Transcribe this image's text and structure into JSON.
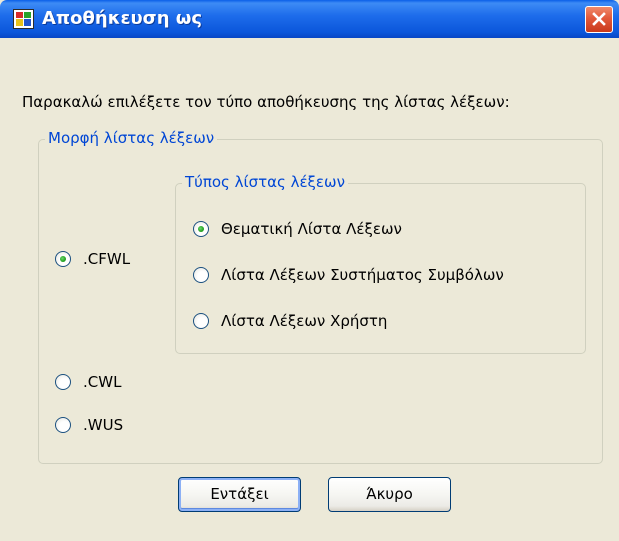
{
  "window": {
    "title": "Αποθήκευση ως",
    "accent_color": "#0A5FE8",
    "close_icon": "close-icon"
  },
  "prompt": "Παρακαλώ επιλέξετε τον τύπο αποθήκευσης της λίστας λέξεων:",
  "format_group": {
    "legend": "Μορφή λίστας λέξεων",
    "options": [
      {
        "label": ".CFWL",
        "checked": true
      },
      {
        "label": ".CWL",
        "checked": false
      },
      {
        "label": ".WUS",
        "checked": false
      }
    ]
  },
  "type_group": {
    "legend": "Τύπος λίστας λέξεων",
    "options": [
      {
        "label": "Θεματική Λίστα Λέξεων",
        "checked": true
      },
      {
        "label": "Λίστα Λέξεων Συστήματος Συμβόλων",
        "checked": false
      },
      {
        "label": "Λίστα Λέξεων Χρήστη",
        "checked": false
      }
    ]
  },
  "buttons": {
    "ok": "Εντάξει",
    "cancel": "Άκυρο"
  }
}
